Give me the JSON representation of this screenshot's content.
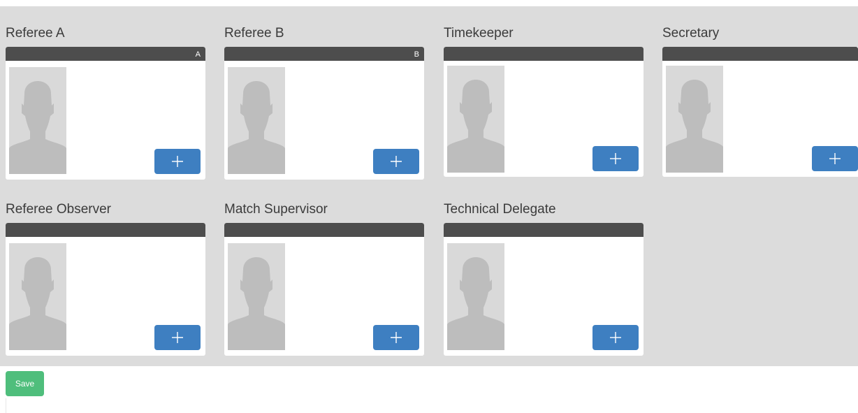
{
  "officials": [
    {
      "title": "Referee A",
      "badge": "A",
      "add_label": "+"
    },
    {
      "title": "Referee B",
      "badge": "B",
      "add_label": "+"
    },
    {
      "title": "Timekeeper",
      "badge": "",
      "add_label": "+"
    },
    {
      "title": "Secretary",
      "badge": "",
      "add_label": "+"
    },
    {
      "title": "Referee Observer",
      "badge": "",
      "add_label": "+"
    },
    {
      "title": "Match Supervisor",
      "badge": "",
      "add_label": "+"
    },
    {
      "title": "Technical Delegate",
      "badge": "",
      "add_label": "+"
    }
  ],
  "save_label": "Save",
  "colors": {
    "panel_bg": "#dcdcdc",
    "card_header": "#4d4d4d",
    "add_button": "#3e7fc1",
    "save_button": "#4fbe7c",
    "avatar_placeholder": "#bdbdbd"
  },
  "icons": {
    "avatar": "person-silhouette-icon",
    "add": "plus-icon"
  }
}
